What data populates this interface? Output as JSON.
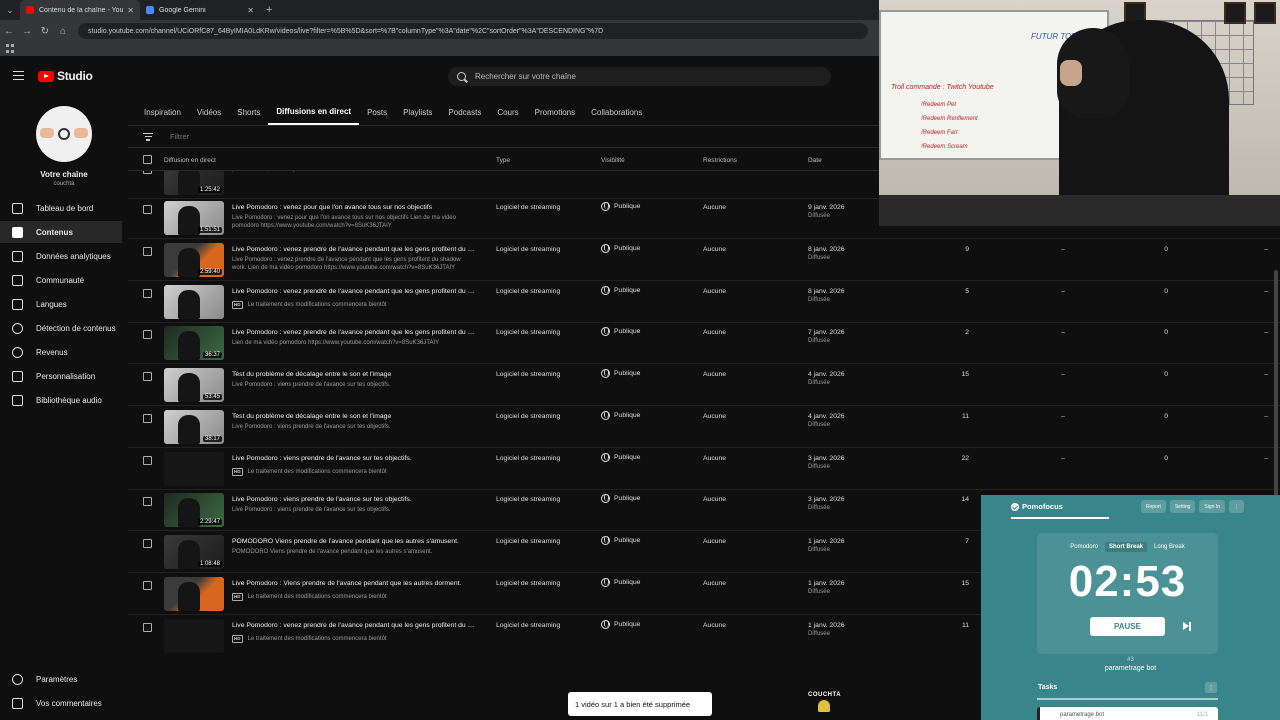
{
  "browser": {
    "tabs": [
      {
        "label": "Contenu de la chaîne - YouTub",
        "active": true,
        "favicon_color": "#ff0000"
      },
      {
        "label": "Google Gemini",
        "active": false,
        "favicon_color": "#4a8af4"
      }
    ],
    "url": "studio.youtube.com/channel/UCiORfC87_64ByIMIA0LdKRw/videos/live?filter=%5B%5D&sort=%7B\"columnType\"%3A\"date\"%2C\"sortOrder\"%3A\"DESCENDING\"%7D"
  },
  "header": {
    "logo_text": "Studio",
    "search_placeholder": "Rechercher sur votre chaîne"
  },
  "sidebar": {
    "channel_title": "Votre chaîne",
    "channel_handle": "couchta",
    "items": [
      {
        "label": "Tableau de bord",
        "icon": "dashboard-icon",
        "active": false
      },
      {
        "label": "Contenus",
        "icon": "content-icon",
        "active": true
      },
      {
        "label": "Données analytiques",
        "icon": "analytics-icon",
        "active": false
      },
      {
        "label": "Communauté",
        "icon": "community-icon",
        "active": false
      },
      {
        "label": "Langues",
        "icon": "languages-icon",
        "active": false
      },
      {
        "label": "Détection de contenus",
        "icon": "copyright-icon",
        "active": false
      },
      {
        "label": "Revenus",
        "icon": "earn-icon",
        "active": false
      },
      {
        "label": "Personnalisation",
        "icon": "customization-icon",
        "active": false
      },
      {
        "label": "Bibliothèque audio",
        "icon": "audio-library-icon",
        "active": false
      }
    ],
    "bottom": [
      {
        "label": "Paramètres",
        "icon": "settings-icon"
      },
      {
        "label": "Vos commentaires",
        "icon": "feedback-icon"
      }
    ]
  },
  "main": {
    "tabs": [
      "Inspiration",
      "Vidéos",
      "Shorts",
      "Diffusions en direct",
      "Posts",
      "Playlists",
      "Podcasts",
      "Cours",
      "Promotions",
      "Collaborations"
    ],
    "active_tab": "Diffusions en direct",
    "filter_placeholder": "Filtrer",
    "columns": {
      "video": "Diffusion en direct",
      "type": "Type",
      "visibility": "Visibilité",
      "restrictions": "Restrictions",
      "date": "Date"
    },
    "rows": [
      {
        "title": "",
        "desc": "Live Pomodoro : venez pour que l'on avance tous sur nos objectifs Lien de ma vidéo pomodoro https://www.youtube.com/watch?v=8SuK36JTAIY",
        "duration": "1:25:42",
        "type": "",
        "visibility": "",
        "restrictions": "",
        "date": "",
        "status": "Diffusée",
        "views": "",
        "comments": "",
        "likes": "",
        "extra": "",
        "notice": false,
        "thumb": "dark"
      },
      {
        "title": "Live Pomodoro : venez pour que l'on avance tous sur nos objectifs",
        "desc": "Live Pomodoro : venez pour que l'on avance tous sur nos objectifs Lien de ma vidéo pomodoro https://www.youtube.com/watch?v=8SuK36JTAIY",
        "duration": "1:51:51",
        "type": "Logiciel de streaming",
        "visibility": "Publique",
        "restrictions": "Aucune",
        "date": "9 janv. 2026",
        "status": "Diffusée",
        "views": "",
        "comments": "",
        "likes": "",
        "extra": "",
        "notice": false,
        "thumb": "light"
      },
      {
        "title": "Live Pomodoro : venez prendre de l'avance pendant que les gens profitent du shad...",
        "desc": "Live Pomodoro : venez prendre de l'avance pendant que les gens profitent du shadow work. Lien de ma vidéo pomodoro https://www.youtube.com/watch?v=8SuK36JTAIY",
        "duration": "2:59:40",
        "type": "Logiciel de streaming",
        "visibility": "Publique",
        "restrictions": "Aucune",
        "date": "8 janv. 2026",
        "status": "Diffusée",
        "views": "9",
        "comments": "–",
        "likes": "0",
        "extra": "–",
        "notice": false,
        "thumb": "orange"
      },
      {
        "title": "Live Pomodoro : venez prendre de l'avance pendant que les gens profitent du shad...",
        "desc": "Le traitement des modifications commencera bientôt",
        "duration": "",
        "type": "Logiciel de streaming",
        "visibility": "Publique",
        "restrictions": "Aucune",
        "date": "8 janv. 2026",
        "status": "Diffusée",
        "views": "5",
        "comments": "–",
        "likes": "0",
        "extra": "–",
        "notice": true,
        "thumb": "light"
      },
      {
        "title": "Live Pomodoro : venez prendre de l'avance pendant que les gens profitent du shad...",
        "desc": "Lien de ma vidéo pomodoro https://www.youtube.com/watch?v=8SuK36JTAIY",
        "duration": "36:37",
        "type": "Logiciel de streaming",
        "visibility": "Publique",
        "restrictions": "Aucune",
        "date": "7 janv. 2026",
        "status": "Diffusée",
        "views": "2",
        "comments": "–",
        "likes": "0",
        "extra": "–",
        "notice": false,
        "thumb": "green"
      },
      {
        "title": "Test du problème de décalage entre le son et l'image",
        "desc": "Live Pomodoro : viens prendre de l'avance sur tes objectifs.",
        "duration": "53:45",
        "type": "Logiciel de streaming",
        "visibility": "Publique",
        "restrictions": "Aucune",
        "date": "4 janv. 2026",
        "status": "Diffusée",
        "views": "15",
        "comments": "–",
        "likes": "0",
        "extra": "–",
        "notice": false,
        "thumb": "light"
      },
      {
        "title": "Test du problème de décalage entre le son et l'image",
        "desc": "Live Pomodoro : viens prendre de l'avance sur tes objectifs.",
        "duration": "38:17",
        "type": "Logiciel de streaming",
        "visibility": "Publique",
        "restrictions": "Aucune",
        "date": "4 janv. 2026",
        "status": "Diffusée",
        "views": "11",
        "comments": "–",
        "likes": "0",
        "extra": "–",
        "notice": false,
        "thumb": "light"
      },
      {
        "title": "Live Pomodoro : viens prendre de l'avance sur tes objectifs.",
        "desc": "Le traitement des modifications commencera bientôt",
        "duration": "",
        "type": "Logiciel de streaming",
        "visibility": "Publique",
        "restrictions": "Aucune",
        "date": "3 janv. 2026",
        "status": "Diffusée",
        "views": "22",
        "comments": "–",
        "likes": "0",
        "extra": "–",
        "notice": true,
        "thumb": "black"
      },
      {
        "title": "Live Pomodoro : viens prendre de l'avance sur tes objectifs.",
        "desc": "Live Pomodoro : viens prendre de l'avance sur tes objectifs.",
        "duration": "2:29:47",
        "type": "Logiciel de streaming",
        "visibility": "Publique",
        "restrictions": "Aucune",
        "date": "3 janv. 2026",
        "status": "Diffusée",
        "views": "14",
        "comments": "",
        "likes": "",
        "extra": "",
        "notice": false,
        "thumb": "green"
      },
      {
        "title": "POMODORO Viens prendre de l'avance pendant que les autres s'amusent.",
        "desc": "POMODORO Viens prendre de l'avance pendant que les autres s'amusent.",
        "duration": "1:08:48",
        "type": "Logiciel de streaming",
        "visibility": "Publique",
        "restrictions": "Aucune",
        "date": "1 janv. 2026",
        "status": "Diffusée",
        "views": "7",
        "comments": "",
        "likes": "",
        "extra": "",
        "notice": false,
        "thumb": "dark"
      },
      {
        "title": "Live Pomodoro : Viens prendre de l'avance pendant que les autres dorment.",
        "desc": "Le traitement des modifications commencera bientôt",
        "duration": "",
        "type": "Logiciel de streaming",
        "visibility": "Publique",
        "restrictions": "Aucune",
        "date": "1 janv. 2026",
        "status": "Diffusée",
        "views": "15",
        "comments": "",
        "likes": "",
        "extra": "",
        "notice": true,
        "thumb": "orange"
      },
      {
        "title": "Live Pomodoro : venez prendre de l'avance pendant que les gens profitent du shad...",
        "desc": "Le traitement des modifications commencera bientôt",
        "duration": "",
        "type": "Logiciel de streaming",
        "visibility": "Publique",
        "restrictions": "Aucune",
        "date": "1 janv. 2026",
        "status": "Diffusée",
        "views": "11",
        "comments": "",
        "likes": "",
        "extra": "",
        "notice": true,
        "thumb": "black"
      }
    ]
  },
  "toast": "1 vidéo sur 1 a bien été supprimée",
  "watermark": "COUCHTA",
  "webcam": {
    "board_lines": [
      "Troll commande : Twitch Youtube",
      "!Redeem Pet",
      "!Redeem Renflement",
      "!Redeem Fart",
      "!Redeem Scream"
    ],
    "board_header": "FUTUR TOP"
  },
  "pomofocus": {
    "brand": "Pomofocus",
    "header_buttons": [
      "Report",
      "Setting",
      "Sign In"
    ],
    "modes": [
      "Pomodoro",
      "Short Break",
      "Long Break"
    ],
    "active_mode": "Short Break",
    "time": "02:53",
    "pause_label": "PAUSE",
    "session": "#3",
    "current_task": "parametrage bot",
    "tasks_title": "Tasks",
    "tasks": [
      {
        "name": "parametrage bot",
        "count": "11/1"
      }
    ],
    "accent": "#38858a"
  }
}
